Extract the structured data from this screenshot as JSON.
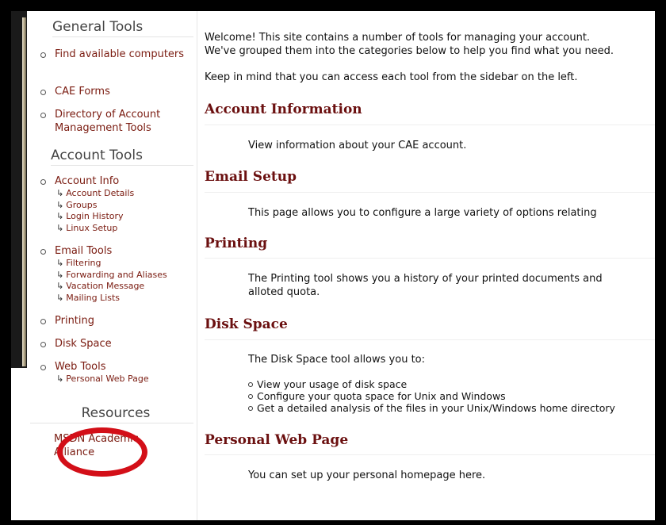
{
  "sidebar": {
    "general_heading": "General Tools",
    "general_items": [
      "Find available computers",
      "CAE Forms",
      "Directory of Account Management Tools"
    ],
    "account_heading": "Account Tools",
    "account_info": {
      "label": "Account Info",
      "subitems": [
        "Account Details",
        "Groups",
        "Login History",
        "Linux Setup"
      ]
    },
    "email_tools": {
      "label": "Email Tools",
      "subitems": [
        "Filtering",
        "Forwarding and Aliases",
        "Vacation Message",
        "Mailing Lists"
      ]
    },
    "printing": "Printing",
    "disk_space": "Disk Space",
    "web_tools": {
      "label": "Web Tools",
      "subitems": [
        "Personal Web Page"
      ]
    },
    "resources_heading": "Resources",
    "msdn": "MSDN Academic Alliance"
  },
  "main": {
    "intro_line1": "Welcome! This site contains a number of tools for managing your account.",
    "intro_line2": "We've grouped them into the categories below to help you find what you need.",
    "intro_line3": "Keep in mind that you can access each tool from the sidebar on the left.",
    "sections": [
      {
        "title": "Account Information",
        "text": "View information about your CAE account."
      },
      {
        "title": "Email Setup",
        "text": "This page allows you to configure a large variety of options relating"
      },
      {
        "title": "Printing",
        "text": "The Printing tool shows you a history of your printed documents and",
        "text2": "alloted quota."
      },
      {
        "title": "Disk Space",
        "text": "The Disk Space tool allows you to:",
        "bullets": [
          "View your usage of disk space",
          "Configure your quota space for Unix and Windows",
          "Get a detailed analysis of the files in your Unix/Windows home directory"
        ]
      },
      {
        "title": "Personal Web Page",
        "text": "You can set up your personal homepage here."
      }
    ]
  },
  "colors": {
    "link": "#7a1b10",
    "title": "#6b1010",
    "highlight": "#d30f18"
  },
  "icons": {
    "subitem_arrow": "return-arrow-icon",
    "bullet": "circle-bullet-icon"
  }
}
